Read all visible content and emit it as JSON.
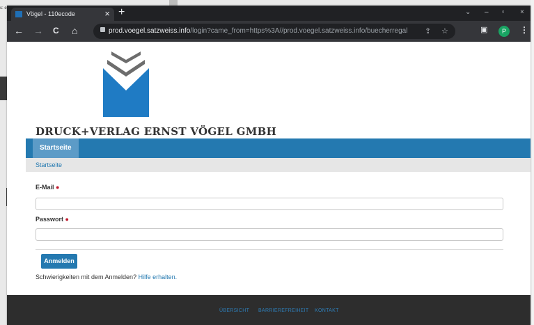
{
  "desktop": {
    "snippet": "s:\ne"
  },
  "browser": {
    "tab_title": "Vögel - 110ecode",
    "tab_close": "×",
    "new_tab": "+",
    "window_controls": {
      "chevron": "⌄",
      "minimize": "–",
      "restore": "▫",
      "close": "×"
    },
    "nav": {
      "back": "←",
      "forward": "→",
      "reload": "C",
      "home": "⌂"
    },
    "url_host": "prod.voegel.satzweiss.info",
    "url_path": "/login?came_from=https%3A//prod.voegel.satzweiss.info/buecherregal",
    "profile_initial": "P",
    "icons": [
      "share-icon",
      "star-icon",
      "sidepanel-icon",
      "menu-icon"
    ]
  },
  "site": {
    "company_name": "DRUCK+VERLAG ERNST VÖGEL GMBH",
    "nav_item": "Startseite",
    "breadcrumb": "Startseite",
    "colors": {
      "primary": "#2479b0",
      "nav_active": "#5c9bc7",
      "logo_blue": "#1f7bc4",
      "logo_gray": "#6d6d6d",
      "required": "#c0182b"
    }
  },
  "form": {
    "email_label": "E-Mail",
    "email_value": "",
    "password_label": "Passwort",
    "password_value": "",
    "required_marker": "●",
    "submit_label": "Anmelden",
    "help_text": "Schwierigkeiten mit dem Anmelden?",
    "help_link": "Hilfe erhalten."
  },
  "footer": {
    "links": [
      "ÜBERSICHT",
      "BARRIEREFREIHEIT",
      "KONTAKT"
    ]
  }
}
